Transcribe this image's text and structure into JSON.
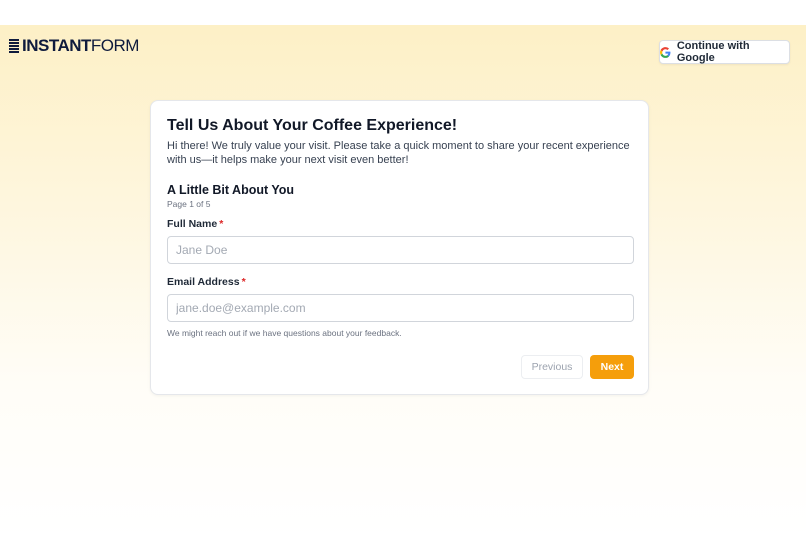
{
  "brand": {
    "logo_bold": "INSTANT",
    "logo_light": "FORM"
  },
  "header": {
    "google_button_label": "Continue with Google",
    "google_icon": "google-g-icon"
  },
  "form": {
    "title": "Tell Us About Your Coffee Experience!",
    "description": "Hi there! We truly value your visit. Please take a quick moment to share your recent experience with us—it helps make your next visit even better!",
    "section_title": "A Little Bit About You",
    "page_indicator": "Page 1 of 5",
    "fields": [
      {
        "label": "Full Name",
        "required_marker": "*",
        "placeholder": "Jane Doe",
        "value": ""
      },
      {
        "label": "Email Address",
        "required_marker": "*",
        "placeholder": "jane.doe@example.com",
        "value": "",
        "help_text": "We might reach out if we have questions about your feedback."
      }
    ],
    "buttons": {
      "previous": "Previous",
      "next": "Next"
    }
  },
  "colors": {
    "accent": "#f59e0b",
    "brand_navy": "#0f1b3d",
    "required": "#dc2626",
    "background_top": "#fdf0c6"
  }
}
